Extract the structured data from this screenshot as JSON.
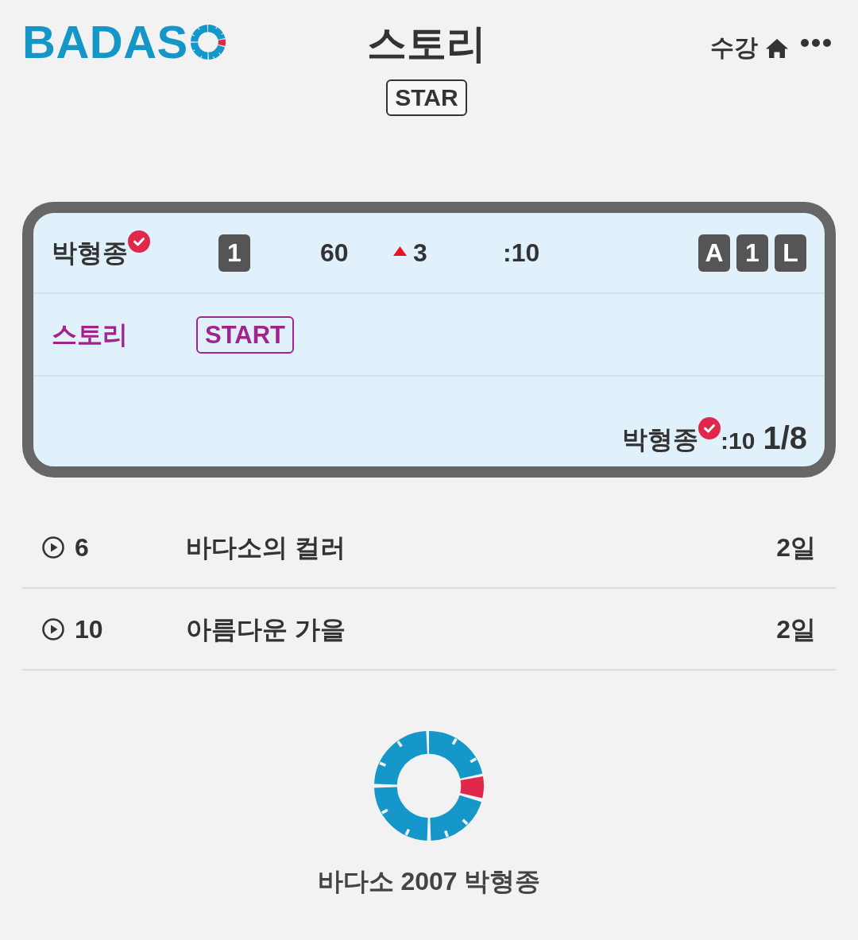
{
  "header": {
    "logo": "BADAS",
    "title": "스토리",
    "badge": "STAR",
    "menu_label": "수강"
  },
  "card": {
    "player": {
      "name": "박형종",
      "verified": true,
      "rank": "1",
      "score": "60",
      "change": {
        "kind": "up",
        "value": "3"
      },
      "time": ":10",
      "tags": [
        "A",
        "1",
        "L"
      ]
    },
    "story": {
      "label": "스토리",
      "badge": "START"
    },
    "summary": {
      "name": "박형종",
      "verified": true,
      "time": ":10",
      "page": "1/8"
    }
  },
  "list": [
    {
      "count": "6",
      "title": "바다소의 컬러",
      "age": "2일"
    },
    {
      "count": "10",
      "title": "아름다운 가을",
      "age": "2일"
    }
  ],
  "footer": {
    "text": "바다소 2007 박형종"
  }
}
